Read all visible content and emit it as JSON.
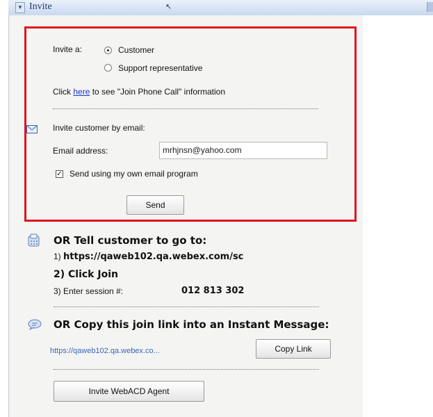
{
  "header": {
    "title": "Invite"
  },
  "invite_as": {
    "label": "Invite a:",
    "option_customer": "Customer",
    "option_support": "Support representative"
  },
  "phone": {
    "prefix": "Click",
    "link": "here",
    "suffix": "to see \"Join Phone Call\" information"
  },
  "email": {
    "section_label": "Invite customer by email:",
    "address_label": "Email address:",
    "address_value": "mrhjnsn@yahoo.com",
    "own_program_label": "Send using my own email program",
    "send_label": "Send"
  },
  "tell": {
    "heading": "OR Tell customer to go to:",
    "step1_prefix": "1)",
    "step1_url": "https://qaweb102.qa.webex.com/sc",
    "step2": "2) Click Join",
    "step3_label": "3) Enter session #:",
    "session_number": "012 813 302"
  },
  "copy": {
    "heading": "OR Copy this join link into an Instant Message:",
    "link_text": "https://qaweb102.qa.webex.co...",
    "copy_button": "Copy Link"
  },
  "footer": {
    "agent_button": "Invite WebACD Agent"
  }
}
